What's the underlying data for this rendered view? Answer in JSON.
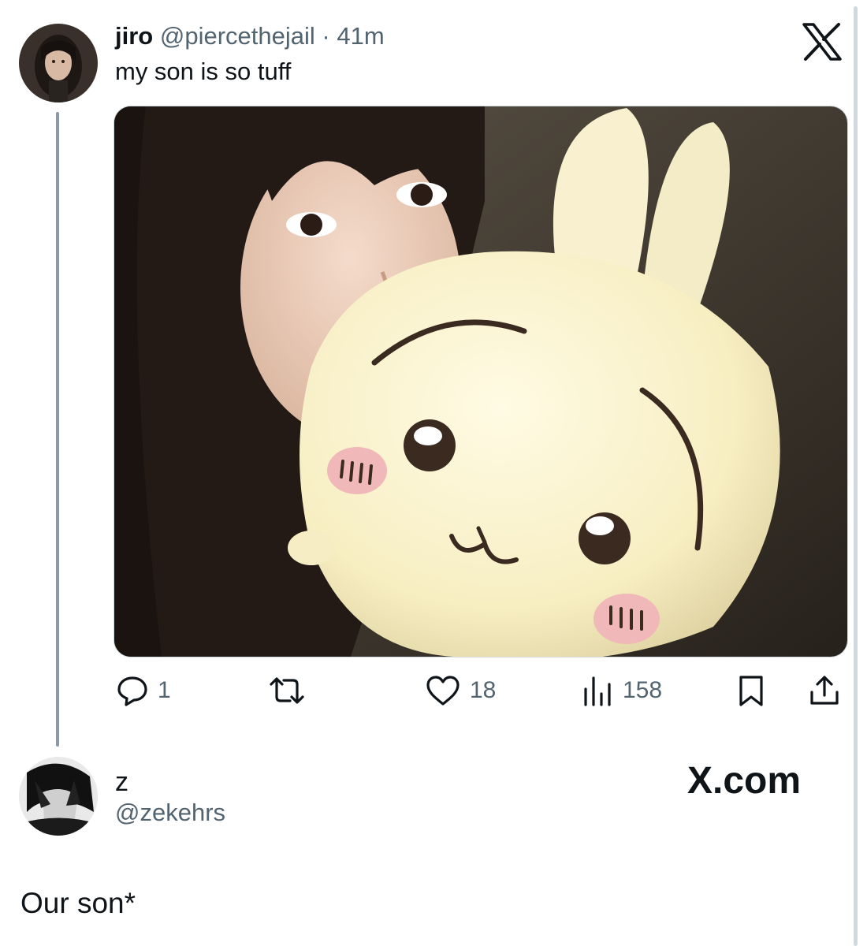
{
  "tweet": {
    "author_name": "jiro",
    "author_handle": "@piercethejail",
    "separator": "·",
    "time": "41m",
    "text": "my son is so tuff",
    "brand_icon": "x-logo-icon",
    "media_description": "selfie-with-white-plush-bunny",
    "actions": {
      "replies": "1",
      "retweets": "",
      "likes": "18",
      "views": "158"
    },
    "icons": [
      "reply-icon",
      "retweet-icon",
      "like-icon",
      "views-icon",
      "bookmark-icon",
      "share-icon"
    ]
  },
  "reply": {
    "author_name": "z",
    "author_handle": "@zekehrs",
    "watermark": "X.com",
    "text": "Our son*"
  },
  "colors": {
    "text_primary": "#0f1419",
    "text_secondary": "#536471",
    "thread_line": "#8b98a5"
  }
}
